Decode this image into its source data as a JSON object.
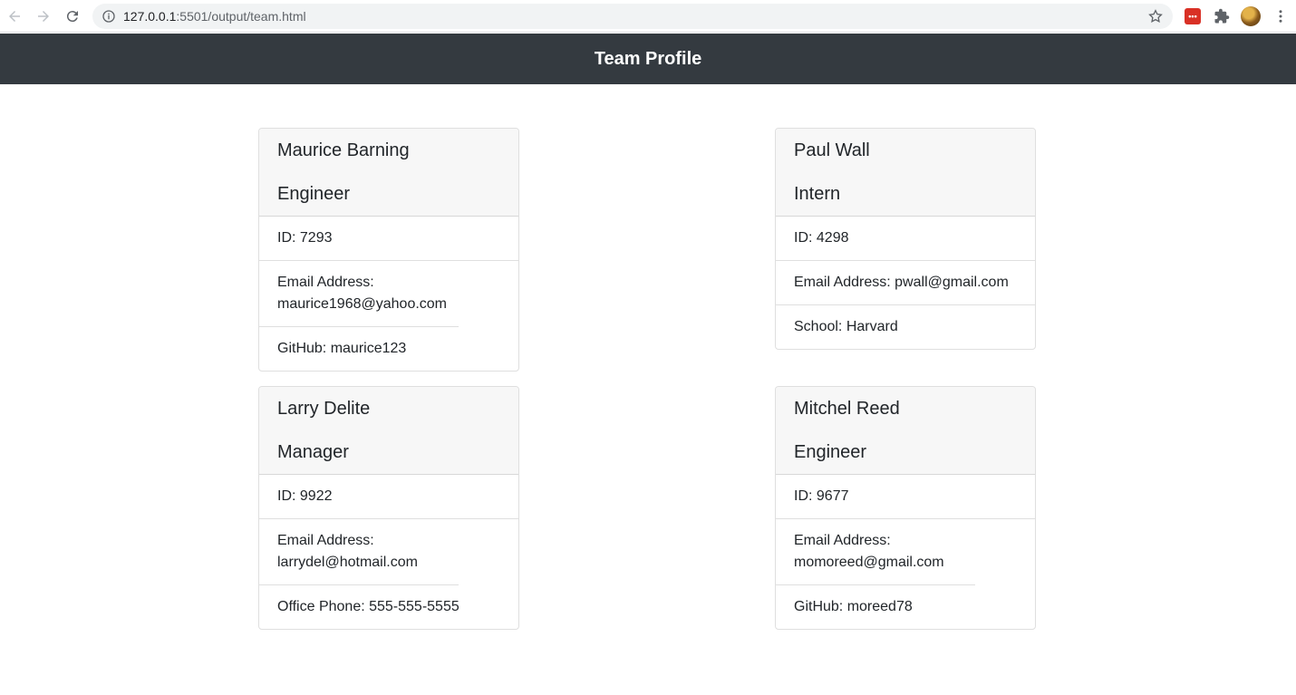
{
  "browser": {
    "url_host": "127.0.0.1",
    "url_rest": ":5501/output/team.html"
  },
  "navbar": {
    "title": "Team Profile"
  },
  "cards": [
    {
      "name": "Maurice Barning",
      "role": "Engineer",
      "id": "ID: 7293",
      "email": "Email Address: maurice1968@yahoo.com",
      "extra": "GitHub: maurice123"
    },
    {
      "name": "Paul Wall",
      "role": "Intern",
      "id": "ID: 4298",
      "email": "Email Address: pwall@gmail.com",
      "extra": "School: Harvard"
    },
    {
      "name": "Larry Delite",
      "role": "Manager",
      "id": "ID: 9922",
      "email": "Email Address: larrydel@hotmail.com",
      "extra": "Office Phone: 555-555-5555"
    },
    {
      "name": "Mitchel Reed",
      "role": "Engineer",
      "id": "ID: 9677",
      "email": "Email Address: momoreed@gmail.com",
      "extra": "GitHub: moreed78"
    }
  ],
  "colors": {
    "navbar_bg": "#343a40",
    "card_header_bg": "#f7f7f7"
  }
}
